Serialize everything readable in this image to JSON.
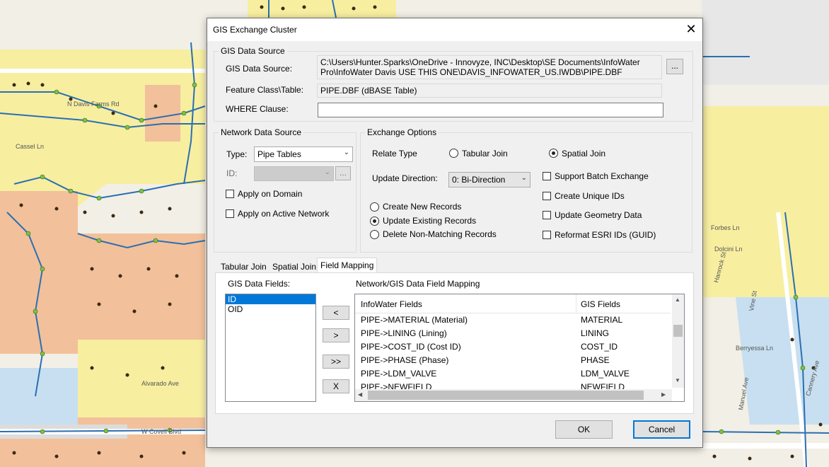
{
  "dialog": {
    "title": "GIS Exchange Cluster",
    "close_glyph": "✕"
  },
  "gis_source": {
    "group_label": "GIS Data Source",
    "source_label": "GIS Data Source:",
    "source_value": "C:\\Users\\Hunter.Sparks\\OneDrive - Innovyze, INC\\Desktop\\SE Documents\\InfoWater Pro\\InfoWater Davis USE THIS ONE\\DAVIS_INFOWATER_US.IWDB\\PIPE.DBF",
    "browse_label": "...",
    "feature_label": "Feature Class\\Table:",
    "feature_value": "PIPE.DBF (dBASE Table)",
    "where_label": "WHERE Clause:",
    "where_value": ""
  },
  "network_source": {
    "group_label": "Network Data Source",
    "type_label": "Type:",
    "type_value": "Pipe Tables",
    "id_label": "ID:",
    "id_value": "",
    "id_browse_label": "...",
    "apply_domain_label": "Apply on Domain",
    "apply_domain_checked": false,
    "apply_active_label": "Apply on Active Network",
    "apply_active_checked": false
  },
  "exchange_options": {
    "group_label": "Exchange Options",
    "relate_type_label": "Relate Type",
    "tabular_join_label": "Tabular Join",
    "spatial_join_label": "Spatial Join",
    "relate_selected": "Spatial Join",
    "update_direction_label": "Update Direction:",
    "update_direction_value": "0: Bi-Direction",
    "record_options": [
      "Create New Records",
      "Update Existing Records",
      "Delete Non-Matching Records"
    ],
    "record_selected": "Update Existing Records",
    "checkboxes": [
      "Support Batch Exchange",
      "Create Unique IDs",
      "Update Geometry Data",
      "Reformat ESRI IDs (GUID)"
    ]
  },
  "tabs": [
    "Tabular Join",
    "Spatial Join",
    "Field Mapping"
  ],
  "active_tab": "Field Mapping",
  "field_mapping": {
    "gis_fields_label": "GIS Data Fields:",
    "gis_fields": [
      "ID",
      "OID"
    ],
    "selected_field": "ID",
    "move_buttons": [
      "<",
      ">",
      ">>",
      "X"
    ],
    "mapping_label": "Network/GIS Data Field Mapping",
    "col_infowater": "InfoWater Fields",
    "col_gis": "GIS Fields",
    "rows": [
      {
        "infowater": "PIPE->MATERIAL (Material)",
        "gis": "MATERIAL"
      },
      {
        "infowater": "PIPE->LINING (Lining)",
        "gis": "LINING"
      },
      {
        "infowater": "PIPE->COST_ID (Cost ID)",
        "gis": "COST_ID"
      },
      {
        "infowater": "PIPE->PHASE (Phase)",
        "gis": "PHASE"
      },
      {
        "infowater": "PIPE->LDM_VALVE",
        "gis": "LDM_VALVE"
      },
      {
        "infowater": "PIPE->NEWFIELD",
        "gis": "NEWFIELD"
      }
    ],
    "scroll_up": "▲",
    "scroll_down": "▼",
    "scroll_left": "◀",
    "scroll_right": "▶"
  },
  "footer": {
    "ok_label": "OK",
    "cancel_label": "Cancel"
  },
  "map_labels": [
    "N Davis Farms Rd",
    "Cassel Ln",
    "W Covell Blvd",
    "Forbes Ln",
    "Dolcini Ln",
    "Berryessa Ln",
    "Alvarado Ave",
    "Cannery Ave",
    "Hanrock St",
    "Vine St",
    "Manuel Ave"
  ],
  "colors": {
    "map_background": "#f2efe6",
    "zone_yellow": "#f7eea0",
    "zone_orange": "#f2c09a",
    "zone_blue": "#c7dff0",
    "zone_gray": "#dcdcdc",
    "pipe_blue": "#2a6fb3",
    "node_green": "#7dc242",
    "hydrant": "#3b2a14",
    "accent": "#0078d7"
  }
}
